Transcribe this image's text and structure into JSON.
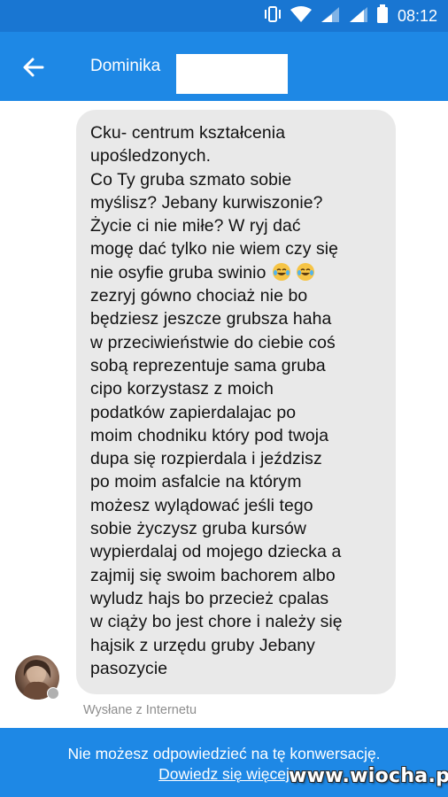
{
  "status_bar": {
    "time": "08:12",
    "icons": [
      "vibrate-icon",
      "wifi-icon",
      "signal-icon",
      "signal-icon",
      "battery-icon"
    ]
  },
  "header": {
    "contact_name": "Dominika",
    "back_icon": "arrow-left-icon"
  },
  "conversation": {
    "message_lines": [
      "Cku- centrum kształcenia",
      "upośledzonych.",
      "Co Ty gruba szmato sobie",
      "myślisz? Jebany kurwiszonie?",
      "Życie ci nie miłe? W ryj dać",
      "mogę dać tylko nie wiem czy się",
      "nie osyfie gruba swinio",
      "zezryj gówno chociaż nie bo",
      "będziesz jeszcze grubsza haha",
      "w przeciwieństwie do ciebie coś",
      "sobą reprezentuje sama gruba",
      "cipo korzystasz z moich",
      "podatków zapierdalajac po",
      "moim chodniku który pod twoja",
      "dupa się rozpierdala i jeździsz",
      "po moim asfalcie na którym",
      "możesz wylądować jeśli tego",
      "sobie życzysz gruba kursów",
      "wypierdalaj od mojego dziecka a",
      "zajmij się swoim bachorem albo",
      "wyludz hajs bo przecież cpalas",
      "w ciąży bo jest chore i należy się",
      "hajsik z urzędu gruby Jebany",
      "pasozycie"
    ],
    "emoji_icons": [
      "tears-of-joy-emoji-icon",
      "tears-of-joy-emoji-icon"
    ],
    "sent_from": "Wysłane z Internetu"
  },
  "footer": {
    "notice": "Nie możesz odpowiedzieć na tę konwersację.",
    "link": "Dowiedz się więcej"
  },
  "watermark": "www.wiocha.pl",
  "colors": {
    "status_bar": "#1976d2",
    "app_bar": "#1e88e5",
    "bubble": "#e9e9e9",
    "footer": "#1e88e5"
  }
}
